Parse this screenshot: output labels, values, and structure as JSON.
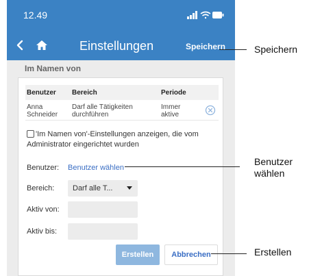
{
  "status_bar": {
    "time": "12.49"
  },
  "nav": {
    "title": "Einstellungen",
    "save_label": "Speichern"
  },
  "section_title": "Im Namen von",
  "table": {
    "headers": {
      "user": "Benutzer",
      "scope": "Bereich",
      "period": "Periode"
    },
    "rows": [
      {
        "user": "Anna Schneider",
        "scope": "Darf alle Tätigkeiten durchführen",
        "period": "Immer aktive"
      }
    ]
  },
  "checkbox": {
    "label": "'Im Namen von'-Einstellungen anzeigen, die vom Administrator eingerichtet wurden",
    "checked": false
  },
  "form": {
    "user_label": "Benutzer:",
    "user_link": "Benutzer wählen",
    "scope_label": "Bereich:",
    "scope_value": "Darf alle T...",
    "active_from_label": "Aktiv von:",
    "active_from_value": "",
    "active_to_label": "Aktiv bis:",
    "active_to_value": ""
  },
  "buttons": {
    "create": "Erstellen",
    "cancel": "Abbrechen"
  },
  "callouts": {
    "save": "Speichern",
    "select_user": "Benutzer\nwählen",
    "create": "Erstellen"
  },
  "colors": {
    "header_blue": "#3b82c4",
    "link_blue": "#3a6ec4",
    "disabled_button": "#8eb7df",
    "page_bg": "#ececec"
  },
  "icons": [
    "signal-icon",
    "wifi-icon",
    "battery-icon",
    "back-arrow-icon",
    "home-icon",
    "remove-circle-icon",
    "dropdown-arrow-icon"
  ]
}
